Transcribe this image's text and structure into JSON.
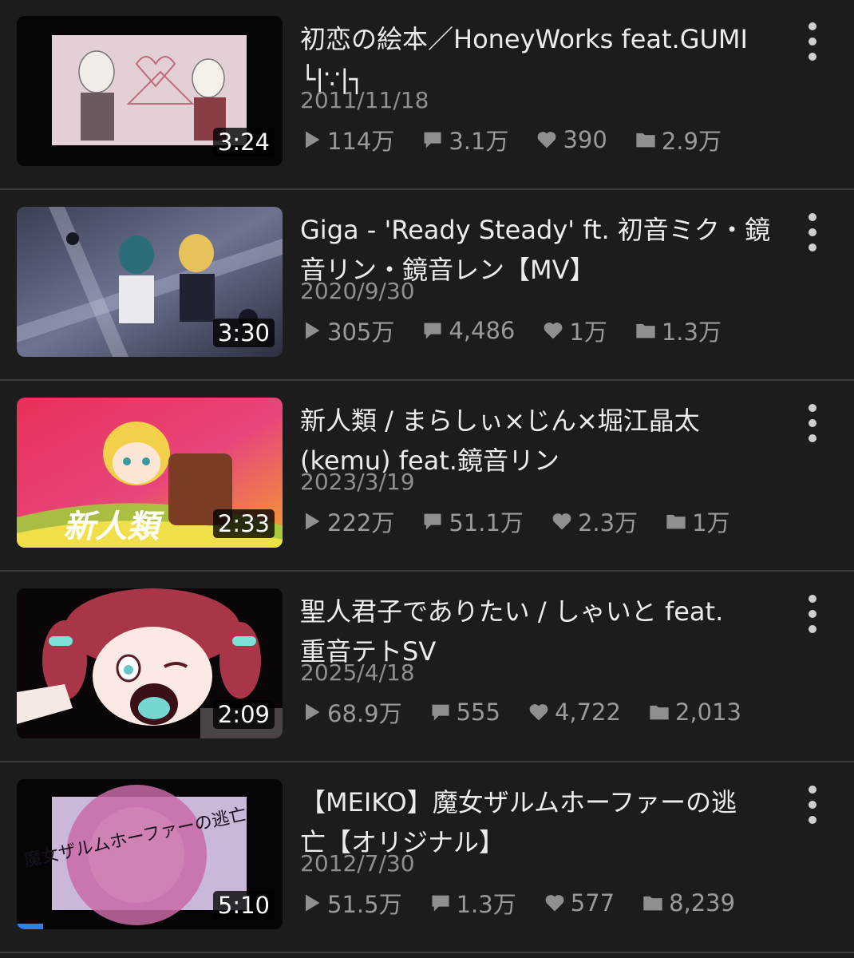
{
  "videos": [
    {
      "title": "初恋の絵本／HoneyWorks feat.GUMI\n└|∵|┐",
      "date": "2011/11/18",
      "duration": "3:24",
      "views": "114万",
      "comments": "3.1万",
      "likes": "390",
      "mylists": "2.9万"
    },
    {
      "title": "Giga - 'Ready Steady' ft. 初音ミク・鏡\n音リン・鏡音レン【MV】",
      "date": "2020/9/30",
      "duration": "3:30",
      "views": "305万",
      "comments": "4,486",
      "likes": "1万",
      "mylists": "1.3万"
    },
    {
      "title": "新人類 / まらしぃ×じん×堀江晶太\n(kemu) feat.鏡音リン",
      "date": "2023/3/19",
      "duration": "2:33",
      "thumb_text": "新人類",
      "views": "222万",
      "comments": "51.1万",
      "likes": "2.3万",
      "mylists": "1万"
    },
    {
      "title": "聖人君子でありたい / しゃいと feat.\n重音テトSV",
      "date": "2025/4/18",
      "duration": "2:09",
      "views": "68.9万",
      "comments": "555",
      "likes": "4,722",
      "mylists": "2,013"
    },
    {
      "title": "【MEIKO】魔女ザルムホーファーの逃\n亡【オリジナル】",
      "date": "2012/7/30",
      "duration": "5:10",
      "thumb_text": "魔女ザルムホーファーの逃亡",
      "views": "51.5万",
      "comments": "1.3万",
      "likes": "577",
      "mylists": "8,239",
      "watch_progress": 0.1
    }
  ]
}
